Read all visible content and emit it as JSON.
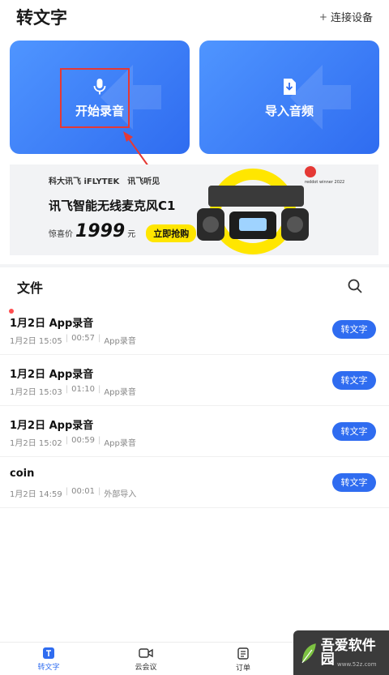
{
  "header": {
    "title": "转文字",
    "connect_label": "连接设备",
    "connect_icon": "plus-icon"
  },
  "actions": {
    "record_label": "开始录音",
    "record_icon": "microphone-icon",
    "import_label": "导入音频",
    "import_icon": "download-file-icon"
  },
  "banner": {
    "brand_1": "科大讯飞 iFLYTEK",
    "brand_2": "讯飞听见",
    "title": "讯飞智能无线麦克风C1",
    "price_label": "惊喜价",
    "price_value": "1999",
    "price_unit": "元",
    "buy_label": "立即抢购",
    "award_text": "reddot winner 2022"
  },
  "files": {
    "section_title": "文件",
    "search_icon": "search-icon",
    "items": [
      {
        "name": "1月2日 App录音",
        "date": "1月2日 15:05",
        "duration": "00:57",
        "source": "App录音",
        "action": "转文字",
        "unread": true
      },
      {
        "name": "1月2日 App录音",
        "date": "1月2日 15:03",
        "duration": "01:10",
        "source": "App录音",
        "action": "转文字",
        "unread": false
      },
      {
        "name": "1月2日 App录音",
        "date": "1月2日 15:02",
        "duration": "00:59",
        "source": "App录音",
        "action": "转文字",
        "unread": false
      },
      {
        "name": "coin",
        "date": "1月2日 14:59",
        "duration": "00:01",
        "source": "外部导入",
        "action": "转文字",
        "unread": false
      }
    ]
  },
  "tabbar": {
    "tabs": [
      {
        "label": "转文字",
        "icon": "text-t-icon",
        "active": true
      },
      {
        "label": "云会议",
        "icon": "video-camera-icon",
        "active": false
      },
      {
        "label": "订单",
        "icon": "order-list-icon",
        "active": false
      }
    ]
  },
  "watermark": {
    "text": "吾爱软件园",
    "sub": "www.52z.com"
  },
  "colors": {
    "primary": "#2f6cf0",
    "card_gradient_start": "#4f95ff",
    "annotation": "#e53935",
    "unread_dot": "#ff4d4f",
    "buy_button": "#ffe600"
  }
}
